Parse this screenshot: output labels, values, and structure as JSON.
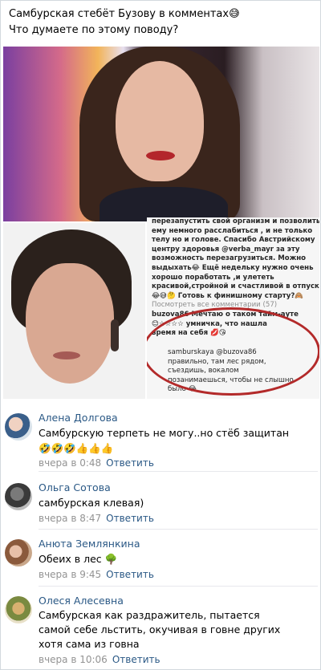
{
  "post": {
    "line1": "Самбурская стебёт Бузову в комментах😅",
    "line2": "Что думаете по этому поводу?"
  },
  "instagram_screenshot": {
    "lines": [
      "перезапустить свой организм и позволить",
      "ему немного расслабиться , и не только",
      "телу но и голове. Спасибо Австрийскому",
      "центру здоровья @verba_mayr за эту",
      "возможность перезагрузиться. Можно",
      "выдыхать😂 Ещё недельку нужно очень",
      "хорошо поработать ,и улететь",
      "красивой,стройной и счастливой в отпуск",
      "😂😅🤔 Готовь к финишному старту?🙈"
    ],
    "view_all": "Посмотреть все комментарии (57)",
    "buzova_user": "buzova86",
    "buzova_text1": "Мечтаю о таком тайм-ауте",
    "buzova_text2": "😊☆☆☆☆ умничка, что нашла",
    "buzova_text3": "время на себя 💋😘",
    "reply_user": "samburskaya",
    "reply_mention": "@buzova86",
    "reply_lines": [
      "правильно, там лес рядом,",
      "съездишь, вокалом",
      "позанимаешься, чтобы не слышно",
      "было 😂"
    ]
  },
  "comments": [
    {
      "name": "Алена Долгова",
      "text_lines": [
        "Самбурскую терпеть не могу..но стёб защитан",
        "🤣🤣🤣👍👍👍"
      ],
      "time": "вчера в 0:48",
      "reply": "Ответить"
    },
    {
      "name": "Ольга Сотова",
      "text_lines": [
        "самбурская клевая)"
      ],
      "time": "вчера в 8:47",
      "reply": "Ответить"
    },
    {
      "name": "Анюта Землянкина",
      "text_lines": [
        "Обеих в лес 🌳"
      ],
      "time": "вчера в 9:45",
      "reply": "Ответить"
    },
    {
      "name": "Олеся Алесевна",
      "text_lines": [
        "Самбурская как раздражитель, пытается",
        "самой себе льстить, окучивая в говне других",
        "хотя сама из говна"
      ],
      "time": "вчера в 10:06",
      "reply": "Ответить"
    }
  ],
  "colors": {
    "link": "#2a5885",
    "meta": "#939393",
    "circle": "#b32a2a"
  }
}
